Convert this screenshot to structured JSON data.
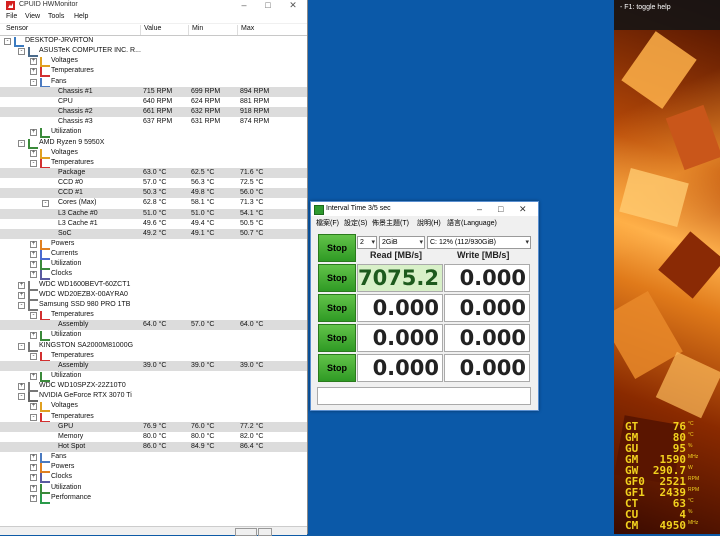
{
  "hwmonitor": {
    "title": "CPUID HWMonitor",
    "menu": [
      "File",
      "View",
      "Tools",
      "Help"
    ],
    "columns": [
      "Sensor",
      "Value",
      "Min",
      "Max"
    ],
    "rows": [
      {
        "label": "DESKTOP-JRVRTON",
        "indent": 0,
        "icon": "computer-icon",
        "box": "-"
      },
      {
        "label": "ASUSTeK COMPUTER INC. R...",
        "indent": 1,
        "icon": "motherboard-icon",
        "box": "-"
      },
      {
        "label": "Voltages",
        "indent": 2,
        "icon": "voltage-icon",
        "box": "+"
      },
      {
        "label": "Temperatures",
        "indent": 2,
        "icon": "thermometer-icon",
        "box": "+"
      },
      {
        "label": "Fans",
        "indent": 2,
        "icon": "fan-icon",
        "box": "-"
      },
      {
        "label": "Chassis #1",
        "indent": 3,
        "value": "715 RPM",
        "min": "699 RPM",
        "max": "894 RPM",
        "shade": true
      },
      {
        "label": "CPU",
        "indent": 3,
        "value": "640 RPM",
        "min": "624 RPM",
        "max": "881 RPM"
      },
      {
        "label": "Chassis #2",
        "indent": 3,
        "value": "661 RPM",
        "min": "632 RPM",
        "max": "918 RPM",
        "shade": true
      },
      {
        "label": "Chassis #3",
        "indent": 3,
        "value": "637 RPM",
        "min": "631 RPM",
        "max": "874 RPM"
      },
      {
        "label": "Utilization",
        "indent": 2,
        "icon": "utilization-icon",
        "box": "+"
      },
      {
        "label": "AMD Ryzen 9 5950X",
        "indent": 1,
        "icon": "cpu-icon",
        "box": "-"
      },
      {
        "label": "Voltages",
        "indent": 2,
        "icon": "voltage-icon",
        "box": "+"
      },
      {
        "label": "Temperatures",
        "indent": 2,
        "icon": "thermometer-icon",
        "box": "-"
      },
      {
        "label": "Package",
        "indent": 3,
        "value": "63.0 °C",
        "min": "62.5 °C",
        "max": "71.6 °C",
        "shade": true
      },
      {
        "label": "CCD #0",
        "indent": 3,
        "value": "57.0 °C",
        "min": "56.3 °C",
        "max": "72.5 °C"
      },
      {
        "label": "CCD #1",
        "indent": 3,
        "value": "50.3 °C",
        "min": "49.8 °C",
        "max": "56.0 °C",
        "shade": true
      },
      {
        "label": "Cores (Max)",
        "indent": 3,
        "value": "62.8 °C",
        "min": "58.1 °C",
        "max": "71.3 °C",
        "box": "-"
      },
      {
        "label": "L3 Cache #0",
        "indent": 3,
        "value": "51.0 °C",
        "min": "51.0 °C",
        "max": "54.1 °C",
        "shade": true
      },
      {
        "label": "L3 Cache #1",
        "indent": 3,
        "value": "49.6 °C",
        "min": "49.4 °C",
        "max": "50.5 °C"
      },
      {
        "label": "SoC",
        "indent": 3,
        "value": "49.2 °C",
        "min": "49.1 °C",
        "max": "50.7 °C",
        "shade": true
      },
      {
        "label": "Powers",
        "indent": 2,
        "icon": "power-icon",
        "box": "+"
      },
      {
        "label": "Currents",
        "indent": 2,
        "icon": "current-icon",
        "box": "+"
      },
      {
        "label": "Utilization",
        "indent": 2,
        "icon": "utilization-icon",
        "box": "+"
      },
      {
        "label": "Clocks",
        "indent": 2,
        "icon": "clock-icon",
        "box": "+"
      },
      {
        "label": "WDC WD1600BEVT-60ZCT1",
        "indent": 1,
        "icon": "drive-icon",
        "box": "+"
      },
      {
        "label": "WDC WD20EZBX-00AYRA0",
        "indent": 1,
        "icon": "drive-icon",
        "box": "+"
      },
      {
        "label": "Samsung SSD 980 PRO 1TB",
        "indent": 1,
        "icon": "drive-icon",
        "box": "-"
      },
      {
        "label": "Temperatures",
        "indent": 2,
        "icon": "thermometer-icon",
        "box": "-"
      },
      {
        "label": "Assembly",
        "indent": 3,
        "value": "64.0 °C",
        "min": "57.0 °C",
        "max": "64.0 °C",
        "shade": true
      },
      {
        "label": "Utilization",
        "indent": 2,
        "icon": "utilization-icon",
        "box": "+"
      },
      {
        "label": "KINGSTON SA2000M81000G",
        "indent": 1,
        "icon": "drive-icon",
        "box": "-"
      },
      {
        "label": "Temperatures",
        "indent": 2,
        "icon": "thermometer-icon",
        "box": "-"
      },
      {
        "label": "Assembly",
        "indent": 3,
        "value": "39.0 °C",
        "min": "39.0 °C",
        "max": "39.0 °C",
        "shade": true
      },
      {
        "label": "Utilization",
        "indent": 2,
        "icon": "utilization-icon",
        "box": "+"
      },
      {
        "label": "WDC WD10SPZX-22Z10T0",
        "indent": 1,
        "icon": "drive-icon",
        "box": "+"
      },
      {
        "label": "NVIDIA GeForce RTX 3070 Ti",
        "indent": 1,
        "icon": "gpu-icon",
        "box": "-"
      },
      {
        "label": "Voltages",
        "indent": 2,
        "icon": "voltage-icon",
        "box": "+"
      },
      {
        "label": "Temperatures",
        "indent": 2,
        "icon": "thermometer-icon",
        "box": "-"
      },
      {
        "label": "GPU",
        "indent": 3,
        "value": "76.9 °C",
        "min": "76.0 °C",
        "max": "77.2 °C",
        "shade": true
      },
      {
        "label": "Memory",
        "indent": 3,
        "value": "80.0 °C",
        "min": "80.0 °C",
        "max": "82.0 °C"
      },
      {
        "label": "Hot Spot",
        "indent": 3,
        "value": "86.0 °C",
        "min": "84.9 °C",
        "max": "86.4 °C",
        "shade": true
      },
      {
        "label": "Fans",
        "indent": 2,
        "icon": "fan-icon",
        "box": "+"
      },
      {
        "label": "Powers",
        "indent": 2,
        "icon": "power-icon",
        "box": "+"
      },
      {
        "label": "Clocks",
        "indent": 2,
        "icon": "clock-icon",
        "box": "+"
      },
      {
        "label": "Utilization",
        "indent": 2,
        "icon": "utilization-icon",
        "box": "+"
      },
      {
        "label": "Performance",
        "indent": 2,
        "icon": "performance-icon",
        "box": "+"
      }
    ]
  },
  "interval": {
    "title": "Interval Time 3/5 sec",
    "menu": [
      "檔案(F)",
      "設定(S)",
      "佈景主題(T)",
      "說明(H)",
      "語言(Language)"
    ],
    "all_button": "Stop",
    "count": "2",
    "size": "2GiB",
    "drive": "C: 12% (112/930GiB)",
    "read_header": "Read [MB/s]",
    "write_header": "Write [MB/s]",
    "tests": [
      {
        "button": "Stop",
        "read": "7075.2",
        "write": "0.000"
      },
      {
        "button": "Stop",
        "read": "0.000",
        "write": "0.000"
      },
      {
        "button": "Stop",
        "read": "0.000",
        "write": "0.000"
      },
      {
        "button": "Stop",
        "read": "0.000",
        "write": "0.000"
      }
    ]
  },
  "overlay": {
    "help": "- F1: toggle help"
  },
  "osd": [
    {
      "key": "GT",
      "value": "76",
      "unit": "°C"
    },
    {
      "key": "GM",
      "value": "80",
      "unit": "°C"
    },
    {
      "key": "GU",
      "value": "95",
      "unit": "%"
    },
    {
      "key": "GM",
      "value": "1590",
      "unit": "MHz"
    },
    {
      "key": "GW",
      "value": "290.7",
      "unit": "W"
    },
    {
      "key": "GF0",
      "value": "2521",
      "unit": "RPM"
    },
    {
      "key": "GF1",
      "value": "2439",
      "unit": "RPM"
    },
    {
      "key": "CT",
      "value": "63",
      "unit": "°C"
    },
    {
      "key": "CU",
      "value": "4",
      "unit": "%"
    },
    {
      "key": "CM",
      "value": "4950",
      "unit": "MHz"
    }
  ],
  "colors": {
    "desktop": "#0b59a8",
    "stop_green": "#3aa82e",
    "osd_yellow": "#f2d21e",
    "hwm_icon_red": "#d42020"
  }
}
